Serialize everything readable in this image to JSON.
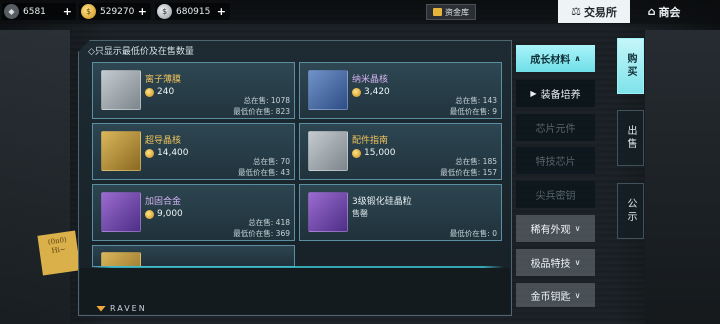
{
  "topbar": {
    "currency_1": "6581",
    "currency_2": "529270",
    "currency_3": "680915",
    "plus": "+",
    "vault_label": "资金库",
    "nav_trade": "交易所",
    "nav_shop": "商会"
  },
  "panel": {
    "header": "◇只显示最低价及在售数量"
  },
  "items": [
    {
      "name": "离子薄膜",
      "price": "240",
      "total_label": "总在售:",
      "total": "1078",
      "low_label": "最低价在售:",
      "low": "823"
    },
    {
      "name": "纳米晶核",
      "price": "3,420",
      "total_label": "总在售:",
      "total": "143",
      "low_label": "最低价在售:",
      "low": "9"
    },
    {
      "name": "超导晶核",
      "price": "14,400",
      "total_label": "总在售:",
      "total": "70",
      "low_label": "最低价在售:",
      "low": "43"
    },
    {
      "name": "配件指南",
      "price": "15,000",
      "total_label": "总在售:",
      "total": "185",
      "low_label": "最低价在售:",
      "low": "157"
    },
    {
      "name": "加固合金",
      "price": "9,000",
      "total_label": "总在售:",
      "total": "418",
      "low_label": "最低价在售:",
      "low": "369"
    },
    {
      "name": "3级锻化硅晶粒",
      "status": "售罄",
      "low_label": "最低价在售:",
      "low": "0"
    }
  ],
  "footer": {
    "brand": "RAVEN"
  },
  "categories": {
    "growth": "成长材料",
    "equip": "装备培养",
    "chip": "芯片元件",
    "special_chip": "特技芯片",
    "weapon_key": "尖兵密钥",
    "rare_look": "稀有外观",
    "premium_skill": "极品特技",
    "gold_key": "金币钥匙"
  },
  "side_tabs": {
    "buy": "购买",
    "sell": "出售",
    "notice": "公示"
  },
  "note": {
    "line1": "(0n0)",
    "line2": "Hi~"
  },
  "colors": {
    "accent": "#7fe3ea",
    "gold": "#f1c45c"
  }
}
